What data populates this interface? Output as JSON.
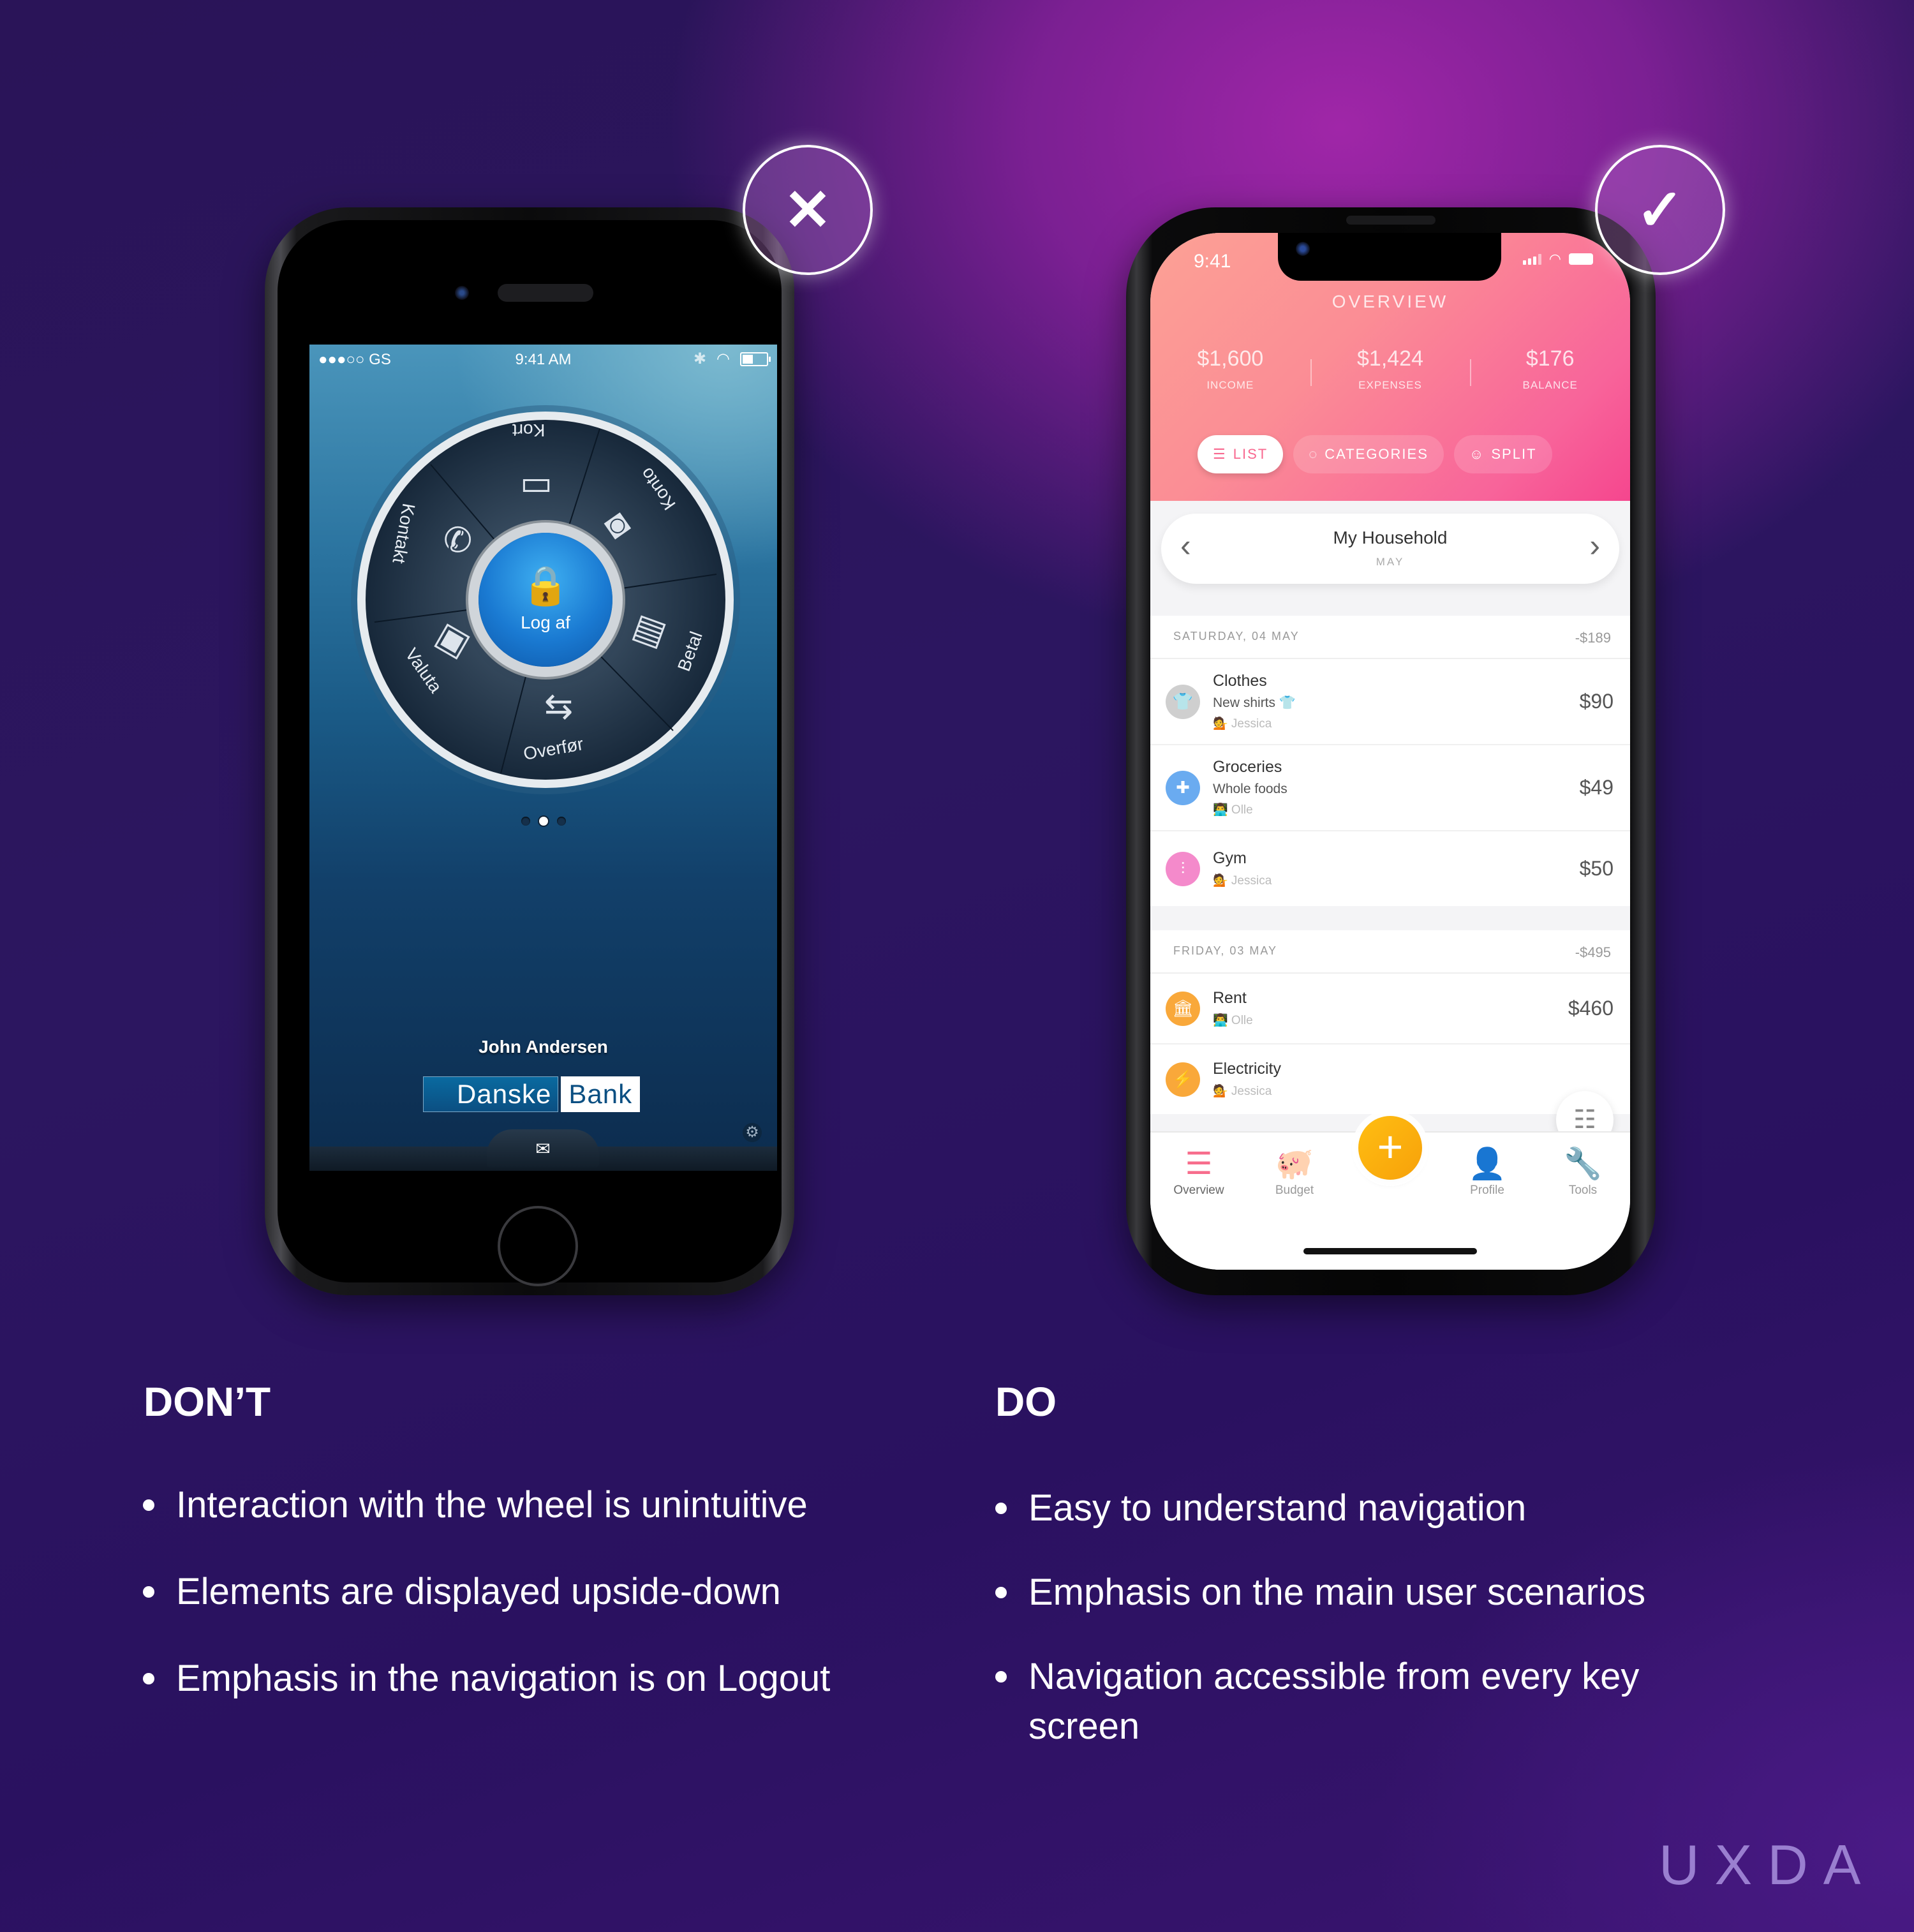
{
  "badges": {
    "dont": {
      "icon": "✕",
      "name": "x-mark"
    },
    "do": {
      "icon": "✓",
      "name": "checkmark"
    }
  },
  "left_phone": {
    "status_bar": {
      "carrier": "●●●○○ GS",
      "time": "9:41 AM",
      "bluetooth": "✱",
      "wifi": "◠"
    },
    "wheel": {
      "center": {
        "label": "Log af",
        "icon": "🔒"
      },
      "segments": [
        {
          "label": "Kort",
          "icon": "▭"
        },
        {
          "label": "Konto",
          "icon": "◙"
        },
        {
          "label": "Betal",
          "icon": "▤"
        },
        {
          "label": "Overfør",
          "icon": "⇆"
        },
        {
          "label": "Valuta",
          "icon": "▣"
        },
        {
          "label": "Kontakt",
          "icon": "✆"
        }
      ]
    },
    "page_indicator": {
      "count": 3,
      "active": 2
    },
    "user_name": "John Andersen",
    "logo": {
      "part1": "Danske",
      "part2": "Bank"
    },
    "settings_icon": "⚙",
    "mail_icon": "✉"
  },
  "right_phone": {
    "status_bar": {
      "time": "9:41"
    },
    "header": {
      "title": "OVERVIEW",
      "stats": [
        {
          "value": "$1,600",
          "label": "INCOME"
        },
        {
          "value": "$1,424",
          "label": "EXPENSES"
        },
        {
          "value": "$176",
          "label": "BALANCE"
        }
      ],
      "tabs": [
        {
          "label": "LIST",
          "icon": "☰",
          "active": true
        },
        {
          "label": "CATEGORIES",
          "icon": "◌",
          "active": false
        },
        {
          "label": "SPLIT",
          "icon": "☺",
          "active": false
        }
      ]
    },
    "household": {
      "title": "My Household",
      "month": "MAY",
      "prev": "‹",
      "next": "›"
    },
    "groups": [
      {
        "date": "SATURDAY, 04 MAY",
        "total": "-$189",
        "items": [
          {
            "name": "Clothes",
            "desc": "New shirts 👕",
            "who": "💁 Jessica",
            "amount": "$90",
            "icon": "👕",
            "color": "#cfcfcf"
          },
          {
            "name": "Groceries",
            "desc": "Whole foods",
            "who": "👨‍💻 Olle",
            "amount": "$49",
            "icon": "✚",
            "color": "#6aabf0"
          },
          {
            "name": "Gym",
            "desc": "",
            "who": "💁 Jessica",
            "amount": "$50",
            "icon": "⫶",
            "color": "#f48acb"
          }
        ]
      },
      {
        "date": "FRIDAY, 03 MAY",
        "total": "-$495",
        "items": [
          {
            "name": "Rent",
            "desc": "",
            "who": "👨‍💻 Olle",
            "amount": "$460",
            "icon": "🏛",
            "color": "#f9a83a"
          },
          {
            "name": "Electricity",
            "desc": "",
            "who": "💁 Jessica",
            "amount": "",
            "icon": "⚡",
            "color": "#f9a83a"
          }
        ]
      }
    ],
    "filter_icon": "☷",
    "tabbar": [
      {
        "label": "Overview",
        "icon": "☰",
        "active": true
      },
      {
        "label": "Budget",
        "icon": "🐖",
        "active": false
      },
      {
        "label": "Profile",
        "icon": "👤",
        "active": false
      },
      {
        "label": "Tools",
        "icon": "🔧",
        "active": false
      }
    ],
    "add_button": "+"
  },
  "dont": {
    "heading": "DON’T",
    "bullets": [
      "Interaction with the wheel is unintuitive",
      "Elements are displayed upside-down",
      "Emphasis in the navigation is on Logout"
    ]
  },
  "do": {
    "heading": "DO",
    "bullets": [
      "Easy to understand navigation",
      "Emphasis on the main user scenarios",
      "Navigation accessible from every key screen"
    ]
  },
  "brand": "UXDA",
  "colors": {
    "accent_pink": "#f76d8c",
    "fab_orange": "#f9a83a",
    "danske_blue": "#0b4f82"
  }
}
